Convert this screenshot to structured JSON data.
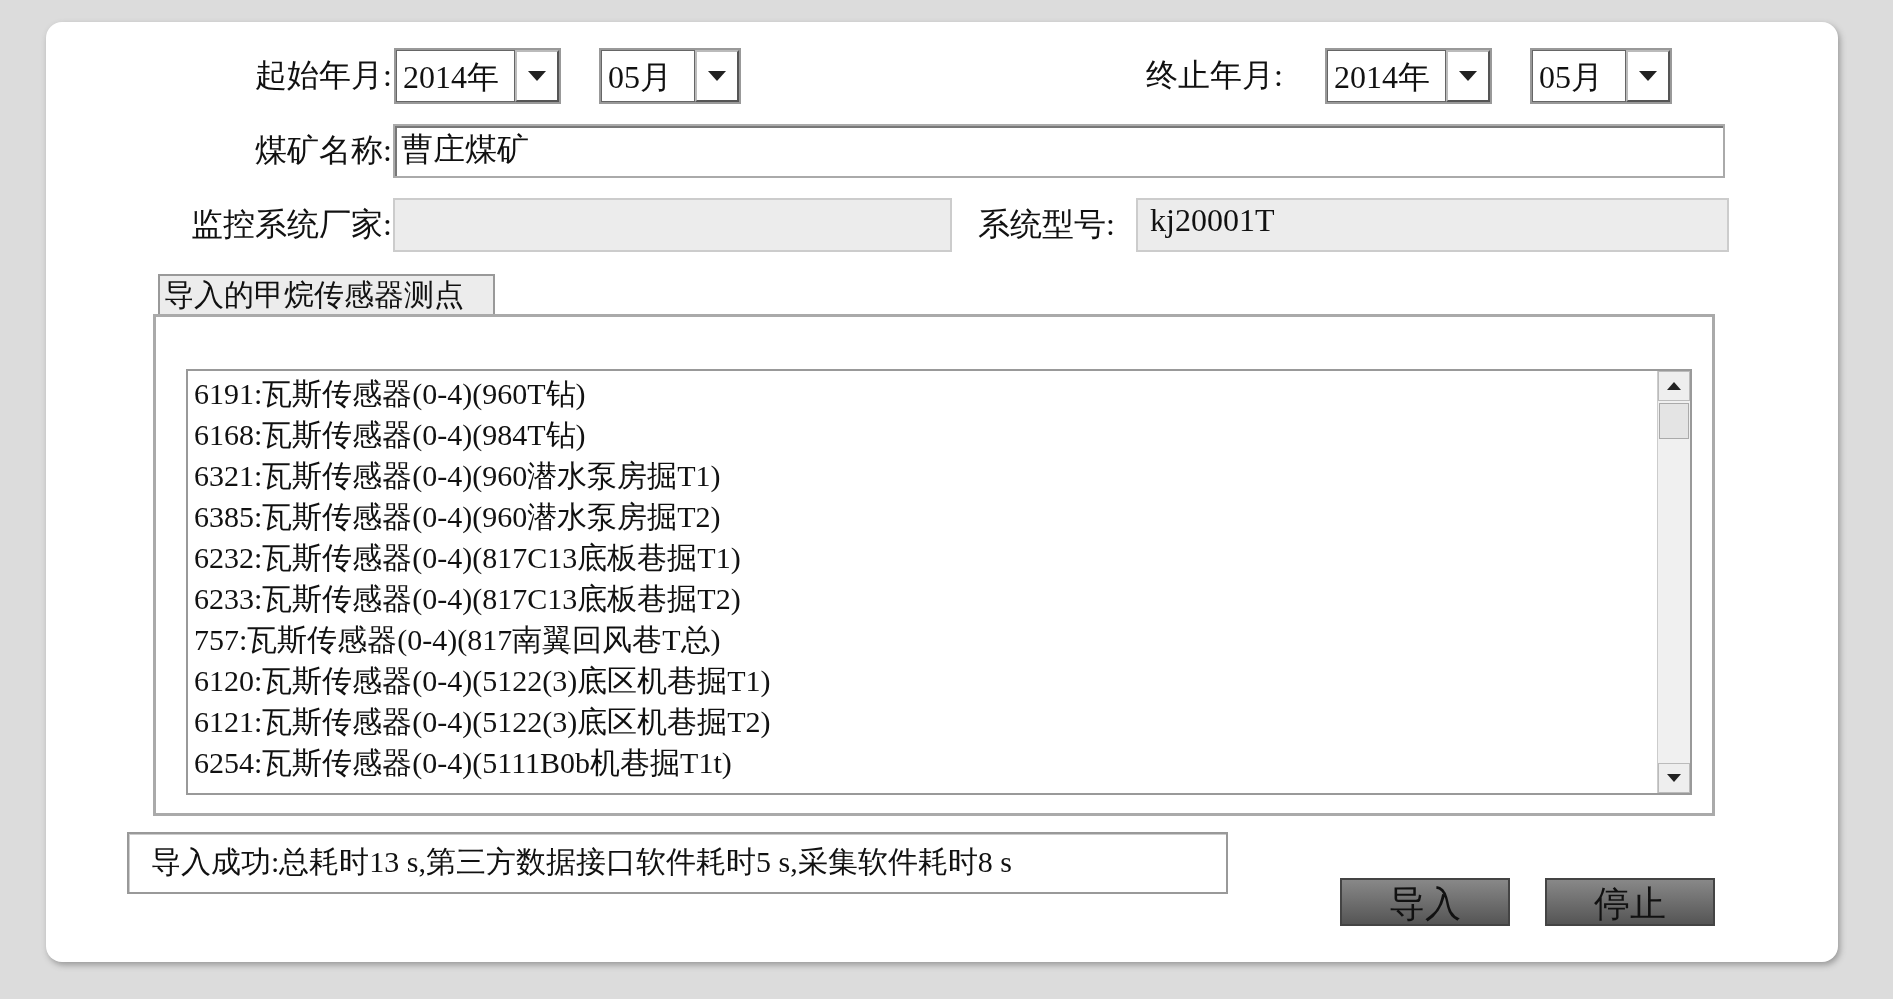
{
  "period": {
    "start": {
      "label": "起始年月:",
      "year": "2014年",
      "month": "05月"
    },
    "end": {
      "label": "终止年月:",
      "year": "2014年",
      "month": "05月"
    }
  },
  "mine_name": {
    "label": "煤矿名称:",
    "value": "曹庄煤矿",
    "disabled": false
  },
  "vendor": {
    "label": "监控系统厂家:",
    "disabled": true
  },
  "system_model": {
    "label": "系统型号:",
    "value": "kj20001T",
    "disabled": true
  },
  "group": {
    "tab": "导入的甲烷传感器测点",
    "items": [
      "6191:瓦斯传感器(0-4)(960T钻)",
      "6168:瓦斯传感器(0-4)(984T钻)",
      "6321:瓦斯传感器(0-4)(960潜水泵房掘T1)",
      "6385:瓦斯传感器(0-4)(960潜水泵房掘T2)",
      "6232:瓦斯传感器(0-4)(817C13底板巷掘T1)",
      "6233:瓦斯传感器(0-4)(817C13底板巷掘T2)",
      "757:瓦斯传感器(0-4)(817南翼回风巷T总)",
      "6120:瓦斯传感器(0-4)(5122(3)底区机巷掘T1)",
      "6121:瓦斯传感器(0-4)(5122(3)底区机巷掘T2)",
      "6254:瓦斯传感器(0-4)(5111B0b机巷掘T1t)"
    ]
  },
  "status": "导入成功:总耗时13 s,第三方数据接口软件耗时5 s,采集软件耗时8 s",
  "buttons": [
    "导入",
    "停止"
  ]
}
